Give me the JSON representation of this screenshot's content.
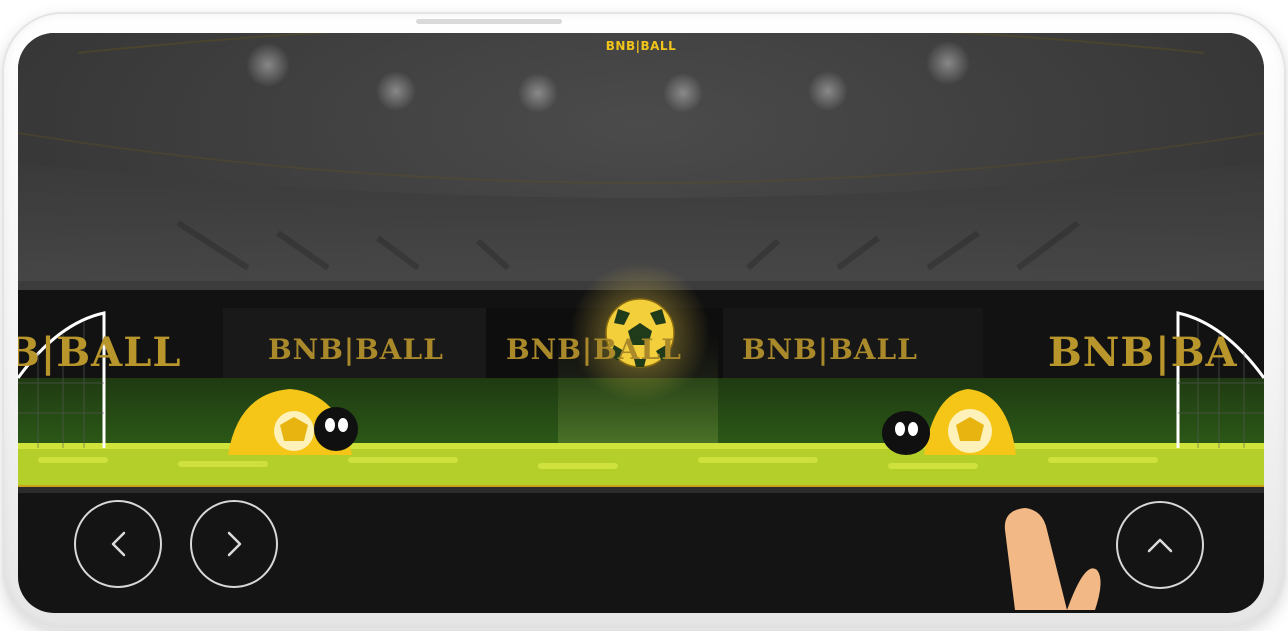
{
  "game": {
    "brand_title": "BNB|BALL",
    "ad_boards": [
      "B|BALL",
      "BNB|BALL",
      "BNB|BALL",
      "BNB|BALL",
      "BNB|BA"
    ]
  },
  "controls": {
    "move_left_icon": "chevron-left-icon",
    "move_right_icon": "chevron-right-icon",
    "jump_icon": "chevron-up-icon"
  },
  "colors": {
    "brand_yellow": "#f0c419",
    "grass": "#b5cf2a",
    "control_bar": "#141414",
    "ring": "#d8d8d8"
  }
}
